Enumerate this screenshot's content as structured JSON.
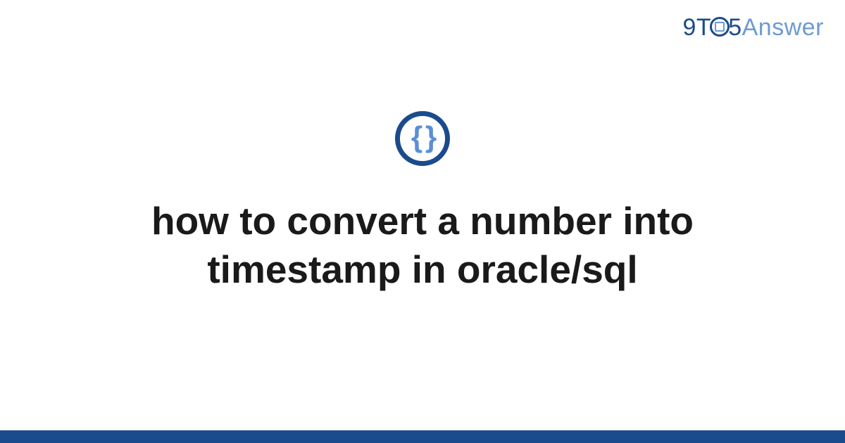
{
  "brand": {
    "part1": "9",
    "part2": "T",
    "part3": "5",
    "part4": "Answer"
  },
  "icon": {
    "glyph": "{ }"
  },
  "title": "how to convert a number into timestamp in oracle/sql",
  "colors": {
    "primary": "#1a4b8c",
    "accent": "#6b9bd1",
    "text": "#1a1a1a"
  }
}
